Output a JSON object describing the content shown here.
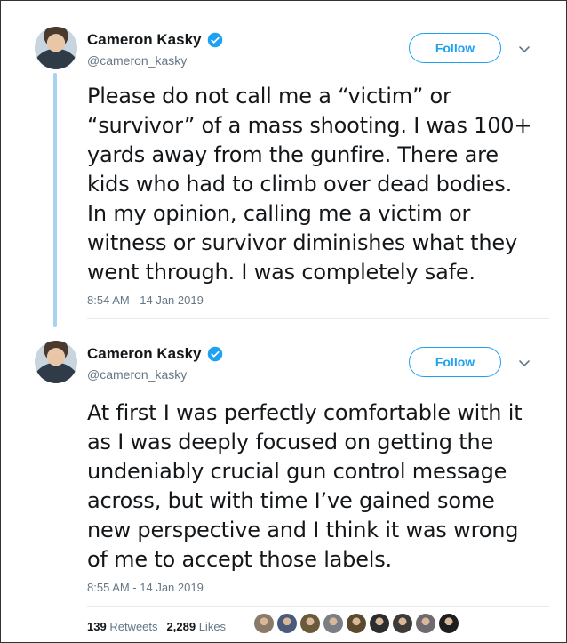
{
  "tweets": [
    {
      "name": "Cameron Kasky",
      "handle": "@cameron_kasky",
      "follow_label": "Follow",
      "text": "Please do not call me a “victim” or\n“survivor” of a mass shooting. I was 100+\nyards away from the gunfire. There are\nkids who had to climb over dead bodies.\nIn my opinion, calling me a victim or\nwitness or survivor diminishes what they\nwent through. I was completely safe.",
      "timestamp": "8:54 AM - 14 Jan 2019"
    },
    {
      "name": "Cameron Kasky",
      "handle": "@cameron_kasky",
      "follow_label": "Follow",
      "text": "At first I was perfectly comfortable with it\nas I was deeply focused on getting the\nundeniably crucial gun control message\nacross, but with time I’ve gained some\nnew perspective and I think it was wrong\nof me to accept those labels.",
      "timestamp": "8:55 AM - 14 Jan 2019"
    }
  ],
  "stats": {
    "retweets_count": "139",
    "retweets_label": "Retweets",
    "likes_count": "2,289",
    "likes_label": "Likes"
  },
  "liker_avatar_colors": [
    "#8a7a6a",
    "#4a5a7a",
    "#6b5a3a",
    "#7a7f86",
    "#5c4a2e",
    "#2c2c2c",
    "#3e3a38",
    "#6e6a70",
    "#1e1e1e"
  ],
  "colors": {
    "accent": "#1da1f2",
    "thread_line": "#a8d3f0",
    "secondary_text": "#657786"
  }
}
